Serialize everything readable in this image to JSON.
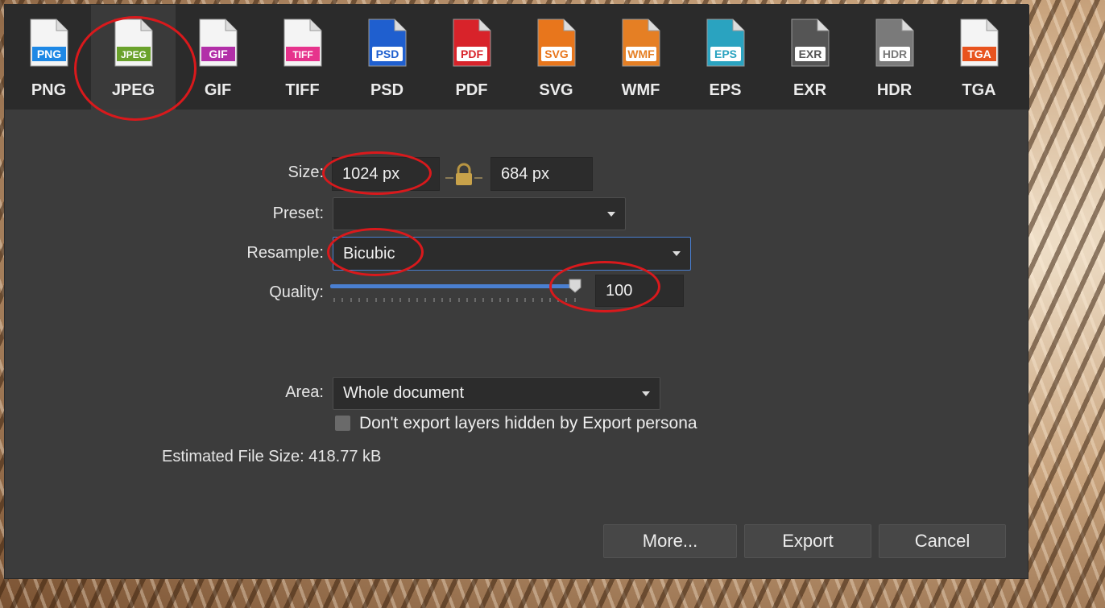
{
  "formats": [
    {
      "name": "PNG",
      "badge": "PNG",
      "color": "#1e88e5",
      "style": "badge"
    },
    {
      "name": "JPEG",
      "badge": "JPEG",
      "color": "#6aa22c",
      "style": "badge",
      "selected": true
    },
    {
      "name": "GIF",
      "badge": "GIF",
      "color": "#b22fa8",
      "style": "badge"
    },
    {
      "name": "TIFF",
      "badge": "TIFF",
      "color": "#e6338c",
      "style": "badge"
    },
    {
      "name": "PSD",
      "badge": "PSD",
      "color": "#1f5fcf",
      "style": "full"
    },
    {
      "name": "PDF",
      "badge": "PDF",
      "color": "#d8232a",
      "style": "full"
    },
    {
      "name": "SVG",
      "badge": "SVG",
      "color": "#e8761c",
      "style": "full"
    },
    {
      "name": "WMF",
      "badge": "WMF",
      "color": "#e57f24",
      "style": "full"
    },
    {
      "name": "EPS",
      "badge": "EPS",
      "color": "#2aa3c0",
      "style": "full"
    },
    {
      "name": "EXR",
      "badge": "EXR",
      "color": "#555555",
      "style": "full"
    },
    {
      "name": "HDR",
      "badge": "HDR",
      "color": "#7a7a7a",
      "style": "full"
    },
    {
      "name": "TGA",
      "badge": "TGA",
      "color": "#e8531e",
      "style": "badge"
    }
  ],
  "form": {
    "size_label": "Size:",
    "width_value": "1024 px",
    "height_value": "684 px",
    "preset_label": "Preset:",
    "preset_value": "",
    "resample_label": "Resample:",
    "resample_value": "Bicubic",
    "quality_label": "Quality:",
    "quality_value": "100",
    "quality_level": 1.0,
    "area_label": "Area:",
    "area_value": "Whole document",
    "checkbox_label": "Don't export layers hidden by Export persona",
    "checkbox_checked": false,
    "file_size_label": "Estimated File Size:",
    "file_size_value": "418.77 kB"
  },
  "buttons": {
    "more": "More...",
    "export": "Export",
    "cancel": "Cancel"
  },
  "colors": {
    "annotation": "#d9191c",
    "accent": "#4a7fd1",
    "lock": "#c8a24a"
  },
  "icons": {
    "lock": "lock-icon",
    "checkbox": "checkbox-icon",
    "caret": "chevron-down-icon"
  }
}
